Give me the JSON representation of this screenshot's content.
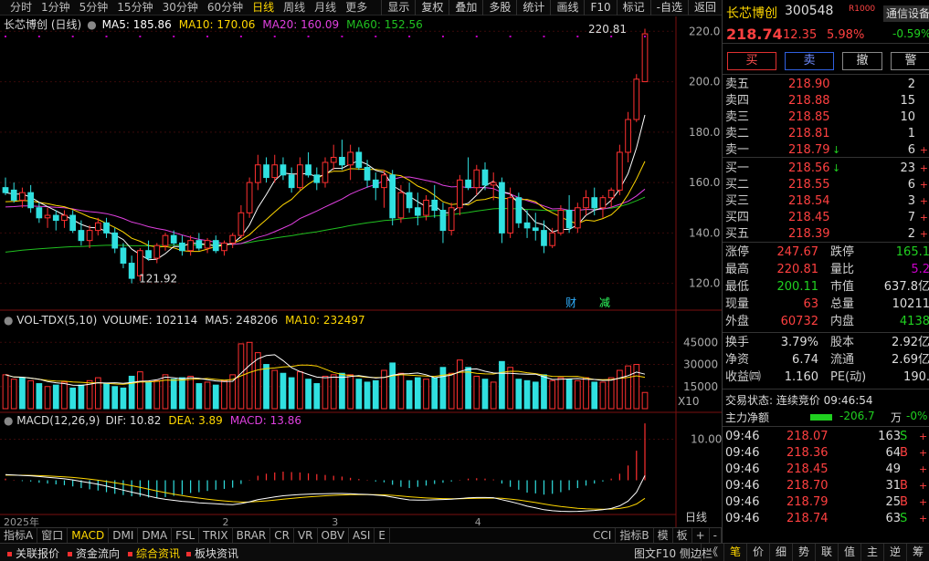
{
  "toolbar": {
    "periods": [
      "分时",
      "1分钟",
      "5分钟",
      "15分钟",
      "30分钟",
      "60分钟",
      "日线",
      "周线",
      "月线",
      "更多"
    ],
    "active_period": "日线",
    "tools": [
      "显示",
      "复权",
      "叠加",
      "多股",
      "统计",
      "画线",
      "F10",
      "标记",
      "-自选",
      "返回"
    ]
  },
  "chart_info": {
    "title": "长芯博创 (日线)",
    "ma5": "MA5: 185.86",
    "ma10": "MA10: 170.06",
    "ma20": "MA20: 160.09",
    "ma60": "MA60: 152.56",
    "high_label": "220.81",
    "low_label": "121.92",
    "markers": [
      "财",
      "减"
    ],
    "vol_title": "VOL-TDX(5,10)",
    "vol_volume": "VOLUME: 102114",
    "vol_ma5": "MA5: 248206",
    "vol_ma10": "MA10: 232497",
    "vol_unit": "X10",
    "macd_title": "MACD(12,26,9)",
    "macd_dif": "DIF: 10.82",
    "macd_dea": "DEA: 3.89",
    "macd_macd": "MACD: 13.86",
    "dates": [
      "2025年",
      "2",
      "3",
      "4"
    ],
    "period_label": "日线"
  },
  "colors": {
    "up": "#ff3030",
    "down": "#30e0e0",
    "ma5": "#ffffff",
    "ma10": "#ffd700",
    "ma20": "#e040e0",
    "ma60": "#20c020",
    "dea": "#ffd700",
    "dif": "#ffffff"
  },
  "chart_data": {
    "type": "candlestick",
    "price_axis": {
      "ticks": [
        "220.0",
        "200.0",
        "180.0",
        "160.0",
        "140.0",
        "120.0"
      ],
      "range": [
        113,
        223
      ]
    },
    "volume_axis": {
      "ticks": [
        "45000",
        "30000",
        "15000"
      ],
      "range": [
        0,
        52000
      ]
    },
    "macd_axis": {
      "ticks": [
        "10.00"
      ],
      "range": [
        -7,
        13
      ]
    },
    "candles": [
      [
        158,
        162,
        155,
        156
      ],
      [
        157,
        160,
        152,
        153
      ],
      [
        153,
        158,
        150,
        156
      ],
      [
        156,
        159,
        148,
        150
      ],
      [
        150,
        152,
        144,
        146
      ],
      [
        146,
        150,
        142,
        147
      ],
      [
        147,
        149,
        141,
        145
      ],
      [
        145,
        149,
        142,
        147
      ],
      [
        147,
        149,
        140,
        141
      ],
      [
        141,
        145,
        135,
        137
      ],
      [
        137,
        143,
        134,
        141
      ],
      [
        141,
        146,
        139,
        144
      ],
      [
        144,
        146,
        138,
        140
      ],
      [
        140,
        142,
        132,
        134
      ],
      [
        134,
        136,
        126,
        128
      ],
      [
        128,
        131,
        120,
        122
      ],
      [
        123,
        134,
        121,
        133
      ],
      [
        133,
        137,
        129,
        130
      ],
      [
        130,
        136,
        128,
        135
      ],
      [
        135,
        140,
        133,
        139
      ],
      [
        139,
        141,
        135,
        136
      ],
      [
        136,
        139,
        131,
        133
      ],
      [
        133,
        139,
        131,
        137
      ],
      [
        137,
        140,
        133,
        134
      ],
      [
        134,
        138,
        132,
        137
      ],
      [
        137,
        139,
        132,
        133
      ],
      [
        133,
        137,
        131,
        136
      ],
      [
        136,
        140,
        134,
        139
      ],
      [
        139,
        151,
        138,
        148
      ],
      [
        148,
        162,
        146,
        160
      ],
      [
        160,
        171,
        157,
        167
      ],
      [
        167,
        170,
        160,
        162
      ],
      [
        162,
        171,
        160,
        167
      ],
      [
        167,
        170,
        161,
        163
      ],
      [
        163,
        166,
        156,
        158
      ],
      [
        158,
        170,
        157,
        167
      ],
      [
        167,
        172,
        162,
        163
      ],
      [
        163,
        166,
        157,
        160
      ],
      [
        160,
        170,
        158,
        168
      ],
      [
        168,
        175,
        165,
        170
      ],
      [
        170,
        177,
        165,
        167
      ],
      [
        167,
        175,
        161,
        172
      ],
      [
        172,
        174,
        165,
        166
      ],
      [
        166,
        169,
        158,
        161
      ],
      [
        161,
        164,
        153,
        158
      ],
      [
        158,
        165,
        150,
        163
      ],
      [
        163,
        165,
        143,
        146
      ],
      [
        146,
        159,
        144,
        156
      ],
      [
        156,
        160,
        148,
        150
      ],
      [
        150,
        156,
        143,
        147
      ],
      [
        147,
        155,
        145,
        153
      ],
      [
        153,
        159,
        146,
        149
      ],
      [
        149,
        152,
        136,
        141
      ],
      [
        141,
        152,
        139,
        150
      ],
      [
        150,
        163,
        147,
        161
      ],
      [
        161,
        170,
        157,
        158
      ],
      [
        158,
        167,
        155,
        165
      ],
      [
        165,
        168,
        157,
        159
      ],
      [
        159,
        164,
        153,
        160
      ],
      [
        160,
        162,
        136,
        140
      ],
      [
        140,
        158,
        138,
        154
      ],
      [
        154,
        156,
        142,
        144
      ],
      [
        144,
        149,
        138,
        142
      ],
      [
        142,
        148,
        137,
        141
      ],
      [
        141,
        145,
        132,
        135
      ],
      [
        135,
        142,
        134,
        140
      ],
      [
        140,
        151,
        139,
        149
      ],
      [
        149,
        155,
        140,
        142
      ],
      [
        142,
        152,
        140,
        150
      ],
      [
        150,
        157,
        147,
        154
      ],
      [
        154,
        158,
        147,
        150
      ],
      [
        150,
        155,
        146,
        154
      ],
      [
        154,
        158,
        150,
        157
      ],
      [
        157,
        175,
        155,
        172
      ],
      [
        172,
        188,
        168,
        185
      ],
      [
        185,
        203,
        184,
        201
      ],
      [
        200,
        221,
        200,
        219
      ]
    ],
    "volumes": [
      [
        23000,
        1
      ],
      [
        20000,
        1
      ],
      [
        21000,
        0
      ],
      [
        19000,
        1
      ],
      [
        17000,
        0
      ],
      [
        15000,
        1
      ],
      [
        16000,
        0
      ],
      [
        18000,
        1
      ],
      [
        14000,
        0
      ],
      [
        16000,
        0
      ],
      [
        19000,
        1
      ],
      [
        21000,
        1
      ],
      [
        17000,
        0
      ],
      [
        15000,
        0
      ],
      [
        14000,
        0
      ],
      [
        22000,
        0
      ],
      [
        25000,
        1
      ],
      [
        18000,
        0
      ],
      [
        19000,
        1
      ],
      [
        23000,
        1
      ],
      [
        20000,
        0
      ],
      [
        21000,
        0
      ],
      [
        22000,
        1
      ],
      [
        17000,
        0
      ],
      [
        18000,
        1
      ],
      [
        16000,
        0
      ],
      [
        19000,
        1
      ],
      [
        23000,
        1
      ],
      [
        44000,
        1
      ],
      [
        45000,
        1
      ],
      [
        38000,
        1
      ],
      [
        30000,
        0
      ],
      [
        26000,
        1
      ],
      [
        24000,
        0
      ],
      [
        21000,
        0
      ],
      [
        25000,
        1
      ],
      [
        20000,
        0
      ],
      [
        17000,
        0
      ],
      [
        22000,
        1
      ],
      [
        23000,
        1
      ],
      [
        24000,
        0
      ],
      [
        23000,
        1
      ],
      [
        20000,
        0
      ],
      [
        18000,
        0
      ],
      [
        19000,
        0
      ],
      [
        26000,
        1
      ],
      [
        31000,
        0
      ],
      [
        24000,
        1
      ],
      [
        19000,
        0
      ],
      [
        21000,
        0
      ],
      [
        20000,
        1
      ],
      [
        21000,
        0
      ],
      [
        28000,
        0
      ],
      [
        24000,
        1
      ],
      [
        33000,
        1
      ],
      [
        28000,
        0
      ],
      [
        22000,
        1
      ],
      [
        20000,
        0
      ],
      [
        18000,
        1
      ],
      [
        32000,
        0
      ],
      [
        28000,
        1
      ],
      [
        20000,
        0
      ],
      [
        19000,
        0
      ],
      [
        18000,
        0
      ],
      [
        23000,
        0
      ],
      [
        19000,
        1
      ],
      [
        21000,
        1
      ],
      [
        20000,
        0
      ],
      [
        19000,
        1
      ],
      [
        21000,
        1
      ],
      [
        18000,
        0
      ],
      [
        18000,
        1
      ],
      [
        21000,
        1
      ],
      [
        26000,
        1
      ],
      [
        29000,
        1
      ],
      [
        30000,
        1
      ],
      [
        11000,
        1
      ]
    ],
    "macd": [
      0.4,
      0.1,
      -0.2,
      -0.3,
      -0.6,
      -0.8,
      -1.0,
      -1.2,
      -1.5,
      -1.9,
      -2.2,
      -2.5,
      -2.9,
      -3.3,
      -3.6,
      -3.9,
      -4.0,
      -4.2,
      -4.3,
      -4.1,
      -3.8,
      -3.5,
      -3.1,
      -2.9,
      -2.6,
      -2.3,
      -2.1,
      -1.8,
      -0.9,
      0.1,
      1.1,
      1.6,
      1.9,
      2.1,
      2.0,
      1.9,
      1.7,
      1.5,
      1.3,
      1.1,
      0.9,
      0.6,
      0.3,
      0.1,
      -0.3,
      -0.5,
      -1.1,
      -1.6,
      -1.9,
      -1.6,
      -1.3,
      -0.9,
      -0.6,
      -0.3,
      0.1,
      0.4,
      0.5,
      0.4,
      0.2,
      -0.8,
      -1.6,
      -2.3,
      -3.0,
      -3.2,
      -3.5,
      -3.3,
      -2.9,
      -2.4,
      -1.9,
      -1.3,
      -0.8,
      -0.3,
      0.4,
      1.6,
      3.6,
      7.2,
      13.86
    ]
  },
  "panel": {
    "name": "长芯博创",
    "code": "300548",
    "tag": "R1000",
    "sector": "通信设备",
    "sector_change": "-0.59%",
    "price": "218.74",
    "change": "12.35",
    "pct": "5.98%",
    "buttons": [
      "买",
      "卖",
      "撤",
      "警"
    ],
    "asks": [
      {
        "label": "卖五",
        "price": "218.90",
        "qty": "2",
        "arrow": ""
      },
      {
        "label": "卖四",
        "price": "218.88",
        "qty": "15",
        "arrow": ""
      },
      {
        "label": "卖三",
        "price": "218.85",
        "qty": "10",
        "arrow": ""
      },
      {
        "label": "卖二",
        "price": "218.81",
        "qty": "1",
        "arrow": ""
      },
      {
        "label": "卖一",
        "price": "218.79",
        "qty": "6",
        "arrow": "↓",
        "flag": "+"
      }
    ],
    "bids": [
      {
        "label": "买一",
        "price": "218.56",
        "qty": "23",
        "arrow": "↓",
        "flag": "+"
      },
      {
        "label": "买二",
        "price": "218.55",
        "qty": "6",
        "arrow": "",
        "flag": "+"
      },
      {
        "label": "买三",
        "price": "218.54",
        "qty": "3",
        "arrow": "",
        "flag": "+"
      },
      {
        "label": "买四",
        "price": "218.45",
        "qty": "7",
        "arrow": "",
        "flag": "+"
      },
      {
        "label": "买五",
        "price": "218.39",
        "qty": "2",
        "arrow": "",
        "flag": "+"
      }
    ],
    "stats1": [
      {
        "k1": "涨停",
        "v1": "247.67",
        "c1": "red",
        "k2": "跌停",
        "v2": "165.1",
        "c2": "green"
      },
      {
        "k1": "最高",
        "v1": "220.81",
        "c1": "red",
        "k2": "量比",
        "v2": "5.2",
        "c2": "purple"
      },
      {
        "k1": "最低",
        "v1": "200.11",
        "c1": "green",
        "k2": "市值",
        "v2": "637.8亿",
        "c2": "white"
      },
      {
        "k1": "现量",
        "v1": "63",
        "c1": "red",
        "k2": "总量",
        "v2": "10211",
        "c2": "white"
      },
      {
        "k1": "外盘",
        "v1": "60732",
        "c1": "red",
        "k2": "内盘",
        "v2": "4138",
        "c2": "green"
      }
    ],
    "stats2": [
      {
        "k1": "换手",
        "v1": "3.79%",
        "c1": "white",
        "k2": "股本",
        "v2": "2.92亿",
        "c2": "white"
      },
      {
        "k1": "净资",
        "v1": "6.74",
        "c1": "white",
        "k2": "流通",
        "v2": "2.69亿",
        "c2": "white"
      },
      {
        "k1": "收益㈣",
        "v1": "1.160",
        "c1": "white",
        "k2": "PE(动)",
        "v2": "190.",
        "c2": "white"
      }
    ],
    "trade_status": "交易状态: 连续竞价 09:46:54",
    "main_flow": {
      "label": "主力净额",
      "value": "-206.7",
      "unit": "万",
      "pct": "-0%"
    },
    "ticks": [
      {
        "t": "09:46",
        "p": "218.07",
        "v": "163",
        "s": "S",
        "c": "green"
      },
      {
        "t": "09:46",
        "p": "218.36",
        "v": "64",
        "s": "B",
        "c": "red"
      },
      {
        "t": "09:46",
        "p": "218.45",
        "v": "49",
        "s": "",
        "c": "white"
      },
      {
        "t": "09:46",
        "p": "218.70",
        "v": "31",
        "s": "B",
        "c": "red"
      },
      {
        "t": "09:46",
        "p": "218.79",
        "v": "25",
        "s": "B",
        "c": "red"
      },
      {
        "t": "09:46",
        "p": "218.74",
        "v": "63",
        "s": "S",
        "c": "green"
      }
    ]
  },
  "indicator_tabs": [
    "指标A",
    "窗口",
    "MACD",
    "DMI",
    "DMA",
    "FSL",
    "TRIX",
    "BRAR",
    "CR",
    "VR",
    "OBV",
    "ASI",
    "E"
  ],
  "indicator_tabs_right": [
    "CCI",
    "指标B",
    "模",
    "板",
    "+",
    "-"
  ],
  "active_indicator": "MACD",
  "bottom": {
    "tabs": [
      "关联报价",
      "资金流向",
      "综合资讯",
      "板块资讯"
    ],
    "right_label": "图文F10 侧边栏",
    "right_icons": [
      "《",
      "笔",
      "价",
      "细",
      "势",
      "联",
      "值",
      "主",
      "逆",
      "筹"
    ]
  }
}
